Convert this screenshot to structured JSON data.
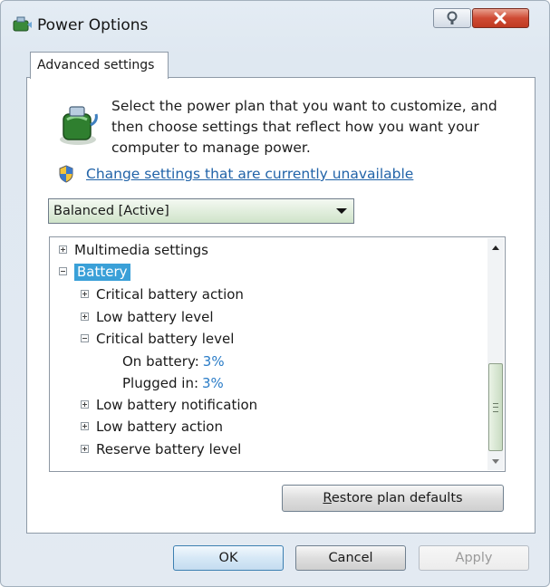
{
  "window": {
    "title": "Power Options"
  },
  "tab": {
    "label": "Advanced settings"
  },
  "description": "Select the power plan that you want to customize, and then choose settings that reflect how you want your computer to manage power.",
  "change_link": "Change settings that are currently unavailable",
  "plan_select": {
    "value": "Balanced [Active]"
  },
  "tree": {
    "multimedia": "Multimedia settings",
    "battery": "Battery",
    "critical_action": "Critical battery action",
    "low_level": "Low battery level",
    "critical_level": "Critical battery level",
    "on_battery_label": "On battery:",
    "on_battery_value": "3%",
    "plugged_in_label": "Plugged in:",
    "plugged_in_value": "3%",
    "low_notification": "Low battery notification",
    "low_action": "Low battery action",
    "reserve_level": "Reserve battery level"
  },
  "buttons": {
    "restore_mnemonic": "R",
    "restore_rest": "estore plan defaults",
    "ok": "OK",
    "cancel": "Cancel",
    "apply": "Apply"
  },
  "colors": {
    "link": "#2163a8",
    "selection": "#3aa0d8",
    "value": "#2a7cc7"
  }
}
